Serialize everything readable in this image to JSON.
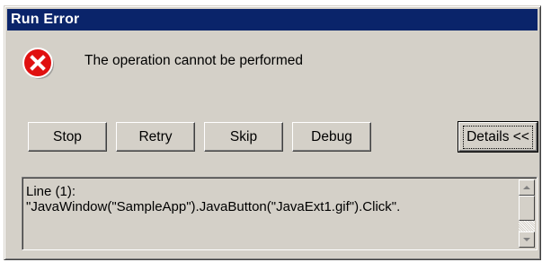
{
  "dialog": {
    "title": "Run Error",
    "message": "The operation cannot be performed",
    "icon": "error-icon"
  },
  "buttons": {
    "stop": "Stop",
    "retry": "Retry",
    "skip": "Skip",
    "debug": "Debug",
    "details": "Details <<"
  },
  "details": {
    "line1": "Line (1):",
    "line2": "\"JavaWindow(\"SampleApp\").JavaButton(\"JavaExt1.gif\").Click\"."
  },
  "colors": {
    "titlebar": "#0a246a",
    "error_red": "#e01010"
  }
}
